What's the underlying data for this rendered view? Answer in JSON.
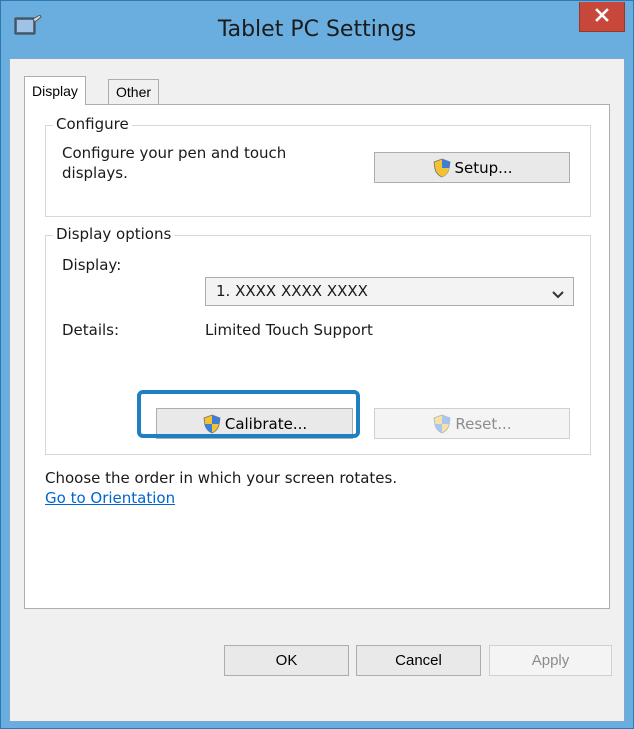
{
  "window": {
    "title": "Tablet PC Settings",
    "icon": "tablet-pc-settings-icon",
    "close_icon": "close-icon"
  },
  "tabs": [
    {
      "label": "Display",
      "active": true
    },
    {
      "label": "Other",
      "active": false
    }
  ],
  "configure": {
    "legend": "Configure",
    "description_line1": "Configure your pen and touch",
    "description_line2": "displays.",
    "setup_label": "Setup..."
  },
  "display_options": {
    "legend": "Display options",
    "display_label": "Display:",
    "display_value": "1.  XXXX XXXX XXXX",
    "details_label": "Details:",
    "details_value": "Limited Touch Support",
    "calibrate_label": "Calibrate...",
    "reset_label": "Reset..."
  },
  "orientation": {
    "text": "Choose the order in which your screen rotates.",
    "link": "Go to Orientation"
  },
  "footer": {
    "ok_label": "OK",
    "cancel_label": "Cancel",
    "apply_label": "Apply"
  },
  "colors": {
    "titlebar": "#6aaedf",
    "close_button": "#c7483a",
    "highlight": "#1f7fc0",
    "link": "#0066cc"
  }
}
